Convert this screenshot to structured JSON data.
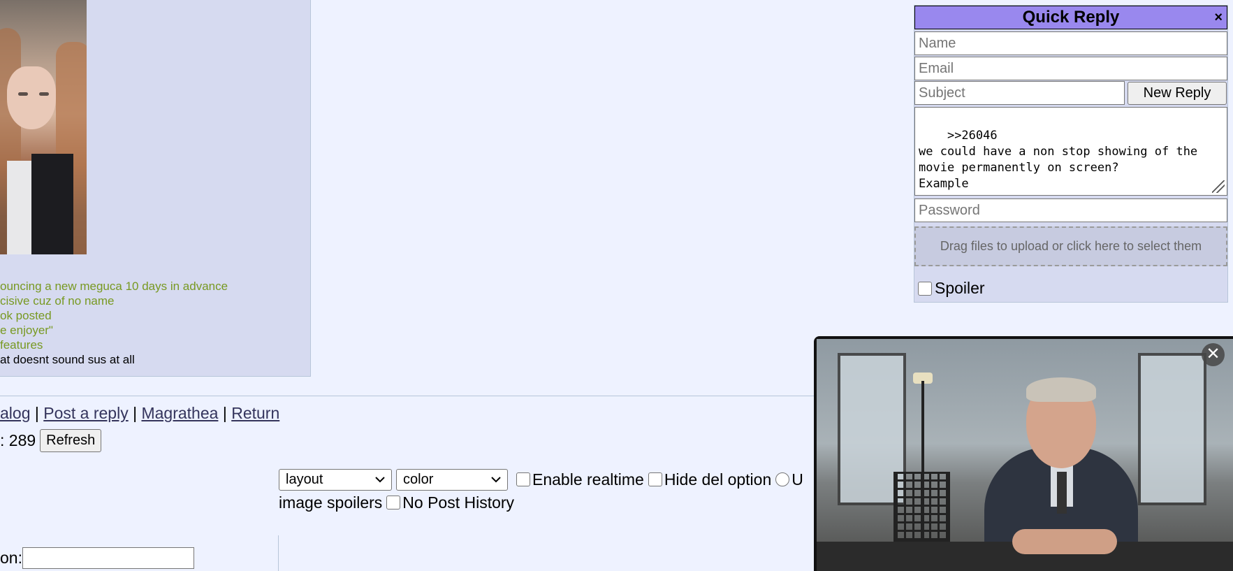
{
  "post": {
    "image_alt": "thumbnail-image",
    "greentext": [
      "ouncing a new meguca 10 days in advance",
      "cisive cuz of no name",
      "ok posted",
      "e enjoyer\"",
      " features"
    ],
    "plain_line": "at doesnt sound sus at all"
  },
  "nav": {
    "catalog": "alog",
    "sep1": " | ",
    "post_reply": "Post a reply",
    "sep2": " | ",
    "magrathea": "Magrathea",
    "sep3": " | ",
    "return": "Return"
  },
  "counter": {
    "prefix": ": 289",
    "refresh_label": "Refresh"
  },
  "options": {
    "layout_value": "layout",
    "color_value": "color",
    "enable_realtime": "Enable realtime",
    "hide_del_option": "Hide del option",
    "radio_label_partial": "U",
    "image_spoilers": "image spoilers",
    "no_post_history": "No Post History"
  },
  "filter": {
    "label": "on:"
  },
  "quick_reply": {
    "title": "Quick Reply",
    "close": "×",
    "name_placeholder": "Name",
    "email_placeholder": "Email",
    "subject_placeholder": "Subject",
    "new_reply_label": "New Reply",
    "message": ">>26046\nwe could have a non stop showing of the movie permanently on screen?\nExample",
    "password_placeholder": "Password",
    "drop_label": "Drag files to upload or click here to select them",
    "spoiler_label": "Spoiler"
  },
  "video": {
    "close": "✕"
  }
}
